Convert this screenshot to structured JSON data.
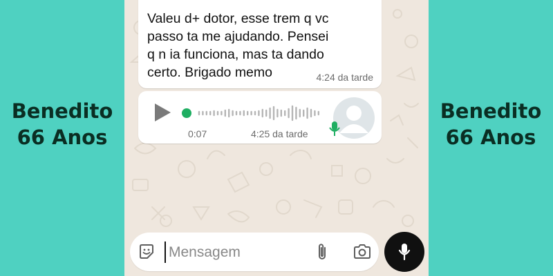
{
  "sidebar_left": {
    "name": "Benedito",
    "age": "66 Anos"
  },
  "sidebar_right": {
    "name": "Benedito",
    "age": "66 Anos"
  },
  "chat": {
    "messages": [
      {
        "type": "text",
        "text": "Valeu d+ dotor, esse trem q vc\npasso ta me ajudando. Pensei\nq n ia funciona, mas ta dando\ncerto. Brigado memo",
        "time": "4:24 da tarde"
      },
      {
        "type": "audio",
        "duration": "0:07",
        "time": "4:25 da tarde",
        "progress": 0.0
      }
    ]
  },
  "composer": {
    "placeholder": "Mensagem"
  },
  "icons": {
    "play": "play-icon",
    "sticker": "sticker-icon",
    "attach": "paperclip-icon",
    "camera": "camera-icon",
    "mic": "microphone-icon",
    "avatar": "default-avatar-icon"
  },
  "colors": {
    "background": "#4fd1c1",
    "side_text": "#0a2e23",
    "chat_wallpaper": "#efe7de",
    "accent_green": "#1fae62",
    "mic_button": "#101010"
  }
}
